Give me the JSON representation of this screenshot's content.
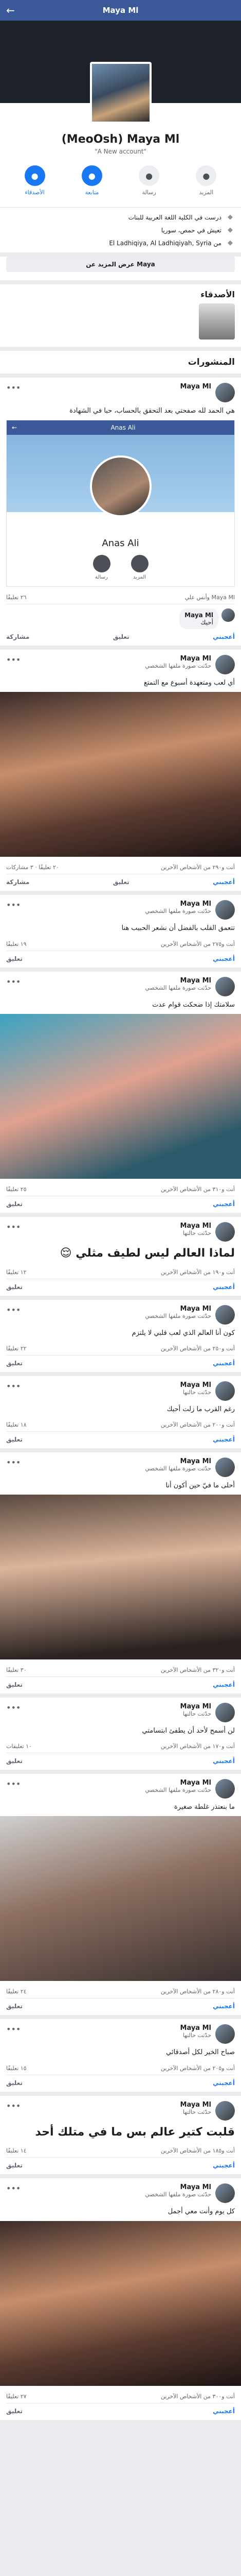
{
  "header": {
    "title": "Maya Ml",
    "back_icon": "arrow-left-icon"
  },
  "profile": {
    "name": "(MeoOsh) Maya Ml",
    "alt_name": "\"A New account\"",
    "actions": [
      {
        "label": "الأصدقاء",
        "icon": "friends-icon",
        "primary": true
      },
      {
        "label": "متابعة",
        "icon": "follow-icon",
        "primary": true
      },
      {
        "label": "رسالة",
        "icon": "message-icon",
        "primary": false
      },
      {
        "label": "المزيد",
        "icon": "more-icon",
        "primary": false
      }
    ],
    "info": [
      {
        "icon": "study-icon",
        "text": "درست في الكلية اللغة العربية للبنات"
      },
      {
        "icon": "home-icon",
        "text": "تعيش في حمص، سوريا"
      },
      {
        "icon": "location-icon",
        "text": "من El Ladhiqiya, Al Ladhiqiyah, Syria"
      }
    ],
    "about_button": "عرض المزيد عن Maya"
  },
  "friends": {
    "title": "الأصدقاء"
  },
  "posts_title": "المنشورات",
  "posts": [
    {
      "author": "Maya Ml",
      "sub": "",
      "time": "",
      "text": "هي الحمد لله صفحتي بعد التحقق بالحساب، حبا في الشهادة",
      "shared": {
        "bar_title": "Anas Ali",
        "name": "Anas Ali",
        "actions": [
          "رسالة",
          "المزيد"
        ]
      },
      "stats_left": "٢٦ تعليقًا",
      "stats_right": "Maya Ml وأنس علي",
      "comment": {
        "author": "Maya Ml",
        "text": "أحبك"
      },
      "buttons": [
        "أعجبني",
        "تعليق",
        "مشاركة"
      ]
    },
    {
      "author": "Maya Ml",
      "sub": "حدّثت صورة ملفها الشخصي",
      "time": "",
      "text": "أي لعب ومتعهدة أسبوع مع التمتع",
      "image": true,
      "stats_left": "٢٠ تعليقًا · ٣ مشاركات",
      "stats_right": "أنت و٢٩٠ من الأشخاص الآخرين",
      "buttons": [
        "أعجبني",
        "تعليق",
        "مشاركة"
      ]
    },
    {
      "author": "Maya Ml",
      "sub": "حدّثت صورة ملفها الشخصي",
      "time": "",
      "text": "تتعمق القلب بالفضل أن نشعر الحبيب هنا",
      "image": false,
      "stats_left": "١٩ تعليقًا",
      "stats_right": "أنت و٢٧٥ من الأشخاص الآخرين",
      "buttons": [
        "أعجبني",
        "تعليق"
      ]
    },
    {
      "author": "Maya Ml",
      "sub": "حدّثت صورة ملفها الشخصي",
      "time": "",
      "text": "سلامتك إذا ضحكت قوام عدت",
      "image": true,
      "stats_left": "٢٥ تعليقًا",
      "stats_right": "أنت و٣١٠ من الأشخاص الآخرين",
      "buttons": [
        "أعجبني",
        "تعليق"
      ]
    },
    {
      "author": "Maya Ml",
      "sub": "حدّثت حالتها",
      "time": "",
      "text": "لماذا العالم ليس لطيف مثلي 😌",
      "big": true,
      "stats_left": "١٢ تعليقًا",
      "stats_right": "أنت و١٩٠ من الأشخاص الآخرين",
      "buttons": [
        "أعجبني",
        "تعليق"
      ]
    },
    {
      "author": "Maya Ml",
      "sub": "حدّثت صورة ملفها الشخصي",
      "time": "",
      "text": "كون أنا العالم الذي لعب قلبي لا يلتزم",
      "image": false,
      "stats_left": "٢٢ تعليقًا",
      "stats_right": "أنت و٢٥٠ من الأشخاص الآخرين",
      "buttons": [
        "أعجبني",
        "تعليق"
      ]
    },
    {
      "author": "Maya Ml",
      "sub": "حدّثت حالتها",
      "time": "",
      "text": "رغم القرب ما زلت أحبك",
      "image": false,
      "stats_left": "١٨ تعليقًا",
      "stats_right": "أنت و٢٠٠ من الأشخاص الآخرين",
      "buttons": [
        "أعجبني",
        "تعليق"
      ]
    },
    {
      "author": "Maya Ml",
      "sub": "حدّثت صورة ملفها الشخصي",
      "time": "",
      "text": "أحلى ما فيّ حين أكون أنا",
      "image": true,
      "stats_left": "٣٠ تعليقًا",
      "stats_right": "أنت و٣٢٠ من الأشخاص الآخرين",
      "buttons": [
        "أعجبني",
        "تعليق"
      ]
    },
    {
      "author": "Maya Ml",
      "sub": "حدّثت حالتها",
      "time": "",
      "text": "لن أسمح لأحد أن يطفئ ابتسامتي",
      "image": false,
      "stats_left": "١٠ تعليقات",
      "stats_right": "أنت و١٧٠ من الأشخاص الآخرين",
      "buttons": [
        "أعجبني",
        "تعليق"
      ]
    },
    {
      "author": "Maya Ml",
      "sub": "حدّثت صورة ملفها الشخصي",
      "time": "",
      "text": "ما بنعتذر غلطة صغيرة",
      "image": true,
      "stats_left": "٢٤ تعليقًا",
      "stats_right": "أنت و٢٨٠ من الأشخاص الآخرين",
      "buttons": [
        "أعجبني",
        "تعليق"
      ]
    },
    {
      "author": "Maya Ml",
      "sub": "حدّثت حالتها",
      "time": "",
      "text": "صباح الخير لكل أصدقائي",
      "image": false,
      "stats_left": "١٥ تعليقًا",
      "stats_right": "أنت و٢٠٥ من الأشخاص الآخرين",
      "buttons": [
        "أعجبني",
        "تعليق"
      ]
    },
    {
      "author": "Maya Ml",
      "sub": "حدّثت حالتها",
      "time": "",
      "text": "قلبت كتير عالم بس ما في متلك أحد",
      "big": true,
      "stats_left": "١٤ تعليقًا",
      "stats_right": "أنت و١٨٥ من الأشخاص الآخرين",
      "buttons": [
        "أعجبني",
        "تعليق"
      ]
    },
    {
      "author": "Maya Ml",
      "sub": "حدّثت صورة ملفها الشخصي",
      "time": "",
      "text": "كل يوم وأنت معي أجمل",
      "image": true,
      "stats_left": "٢٧ تعليقًا",
      "stats_right": "أنت و٣٠٠ من الأشخاص الآخرين",
      "buttons": [
        "أعجبني",
        "تعليق"
      ]
    }
  ]
}
